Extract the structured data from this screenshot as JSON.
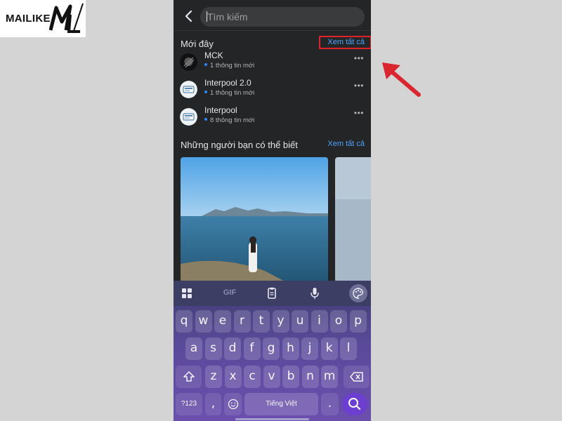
{
  "logo": {
    "text": "MAILIKE"
  },
  "search": {
    "placeholder": "Tìm kiếm"
  },
  "recent": {
    "title": "Mới đây",
    "see_all": "Xem tất cả",
    "items": [
      {
        "name": "MCK",
        "sub": "1 thông tin mới"
      },
      {
        "name": "Interpool 2.0",
        "sub": "1 thông tin mới"
      },
      {
        "name": "Interpool",
        "sub": "8 thông tin mới"
      }
    ]
  },
  "friends": {
    "title": "Những người bạn có thể biết",
    "see_all": "Xem tất cả"
  },
  "keyboard": {
    "toolbar": {
      "gif": "GIF"
    },
    "row1": [
      "q",
      "w",
      "e",
      "r",
      "t",
      "y",
      "u",
      "i",
      "o",
      "p"
    ],
    "row2": [
      "a",
      "s",
      "d",
      "f",
      "g",
      "h",
      "j",
      "k",
      "l"
    ],
    "row3": [
      "z",
      "x",
      "c",
      "v",
      "b",
      "n",
      "m"
    ],
    "num_key": "?123",
    "comma": ",",
    "period": ".",
    "space": "Tiếng Việt"
  },
  "colors": {
    "highlight": "#e0222b",
    "link": "#4da3ff",
    "arrow": "#d9262f"
  }
}
